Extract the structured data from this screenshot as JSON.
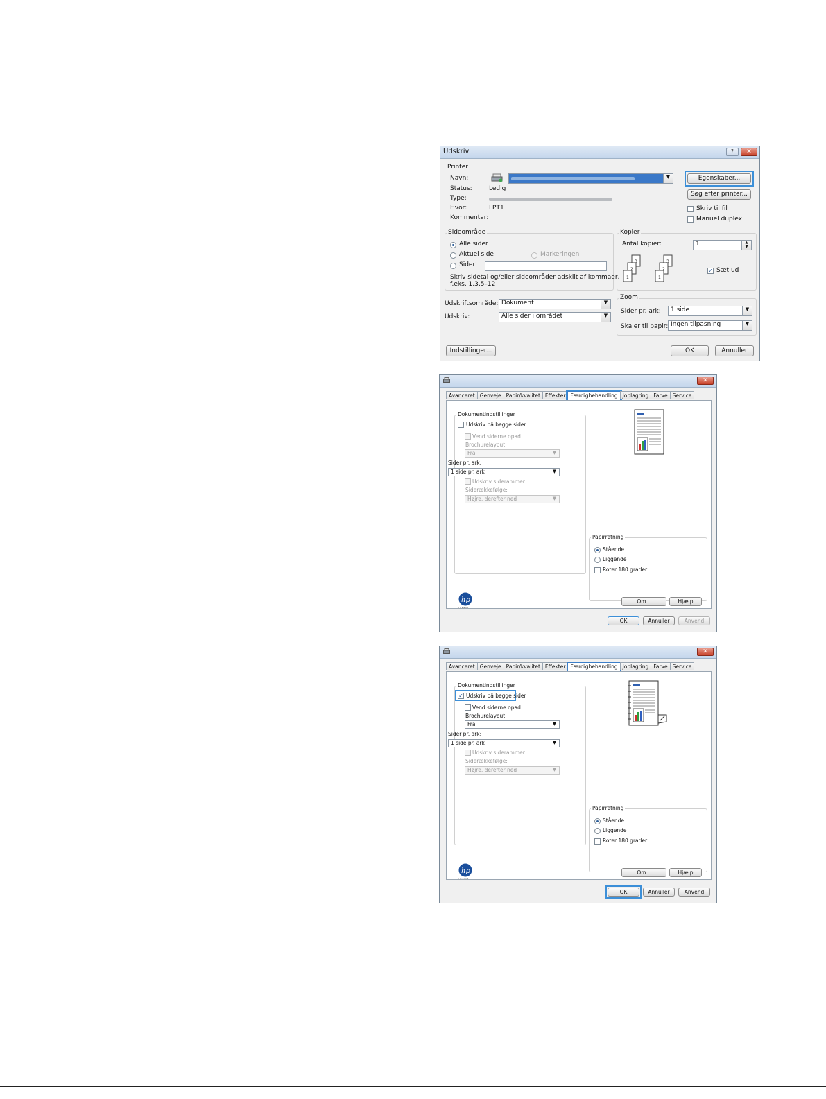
{
  "print_dialog": {
    "title": "Udskriv",
    "help_label": "?",
    "close_label": "✕",
    "printer_group": "Printer",
    "name_label": "Navn:",
    "status_label": "Status:",
    "status_value": "Ledig",
    "type_label": "Type:",
    "where_label": "Hvor:",
    "where_value": "LPT1",
    "comment_label": "Kommentar:",
    "properties_button": "Egenskaber...",
    "find_printer_button": "Søg efter printer...",
    "print_to_file": "Skriv til fil",
    "manual_duplex": "Manuel duplex",
    "page_range_group": "Sideområde",
    "all_pages": "Alle sider",
    "current_page": "Aktuel side",
    "selection": "Markeringen",
    "pages": "Sider:",
    "pages_hint": "Skriv sidetal og/eller sideområder adskilt af kommaer,\nf.eks. 1,3,5–12",
    "copies_group": "Kopier",
    "num_copies_label": "Antal kopier:",
    "num_copies_value": "1",
    "collate": "Sæt ud",
    "print_what_label": "Udskriftsområde:",
    "print_what_value": "Dokument",
    "print_label": "Udskriv:",
    "print_value": "Alle sider i området",
    "zoom_group": "Zoom",
    "pages_per_sheet_label": "Sider pr. ark:",
    "pages_per_sheet_value": "1 side",
    "scale_label": "Skaler til papir:",
    "scale_value": "Ingen tilpasning",
    "options_button": "Indstillinger...",
    "ok_button": "OK",
    "cancel_button": "Annuller"
  },
  "properties_dialog_1": {
    "tabs": [
      "Avanceret",
      "Genveje",
      "Papir/kvalitet",
      "Effekter",
      "Færdigbehandling",
      "Joblagring",
      "Farve",
      "Service"
    ],
    "active_tab": "Færdigbehandling",
    "doc_group": "Dokumentindstillinger",
    "duplex": "Udskriv på begge sider",
    "flip_pages": "Vend siderne opad",
    "booklet_label": "Brochurelayout:",
    "booklet_value": "Fra",
    "pps_label": "Sider pr. ark:",
    "pps_value": "1 side pr. ark",
    "borders": "Udskriv siderammer",
    "order_label": "Siderækkefølge:",
    "order_value": "Højre, derefter ned",
    "orient_group": "Papirretning",
    "portrait": "Stående",
    "landscape": "Liggende",
    "rotate": "Roter 180 grader",
    "about_button": "Om...",
    "help_button": "Hjælp",
    "ok_button": "OK",
    "cancel_button": "Annuller",
    "apply_button": "Anvend"
  },
  "properties_dialog_2": {
    "tabs": [
      "Avanceret",
      "Genveje",
      "Papir/kvalitet",
      "Effekter",
      "Færdigbehandling",
      "Joblagring",
      "Farve",
      "Service"
    ],
    "active_tab": "Færdigbehandling",
    "doc_group": "Dokumentindstillinger",
    "duplex": "Udskriv på begge sider",
    "flip_pages": "Vend siderne opad",
    "booklet_label": "Brochurelayout:",
    "booklet_value": "Fra",
    "pps_label": "Sider pr. ark:",
    "pps_value": "1 side pr. ark",
    "borders": "Udskriv siderammer",
    "order_label": "Siderækkefølge:",
    "order_value": "Højre, derefter ned",
    "orient_group": "Papirretning",
    "portrait": "Stående",
    "landscape": "Liggende",
    "rotate": "Roter 180 grader",
    "about_button": "Om...",
    "help_button": "Hjælp",
    "ok_button": "OK",
    "cancel_button": "Annuller",
    "apply_button": "Anvend"
  },
  "icons": {
    "printer": "printer-icon",
    "close": "close-icon",
    "help": "help-icon",
    "dropdown": "chevron-down-icon",
    "hp_logo": "hp-logo-icon",
    "document_preview": "document-preview-icon"
  },
  "colors": {
    "highlight": "#3c8fd8",
    "selection": "#3a78c8",
    "close_button": "#c8432b"
  }
}
